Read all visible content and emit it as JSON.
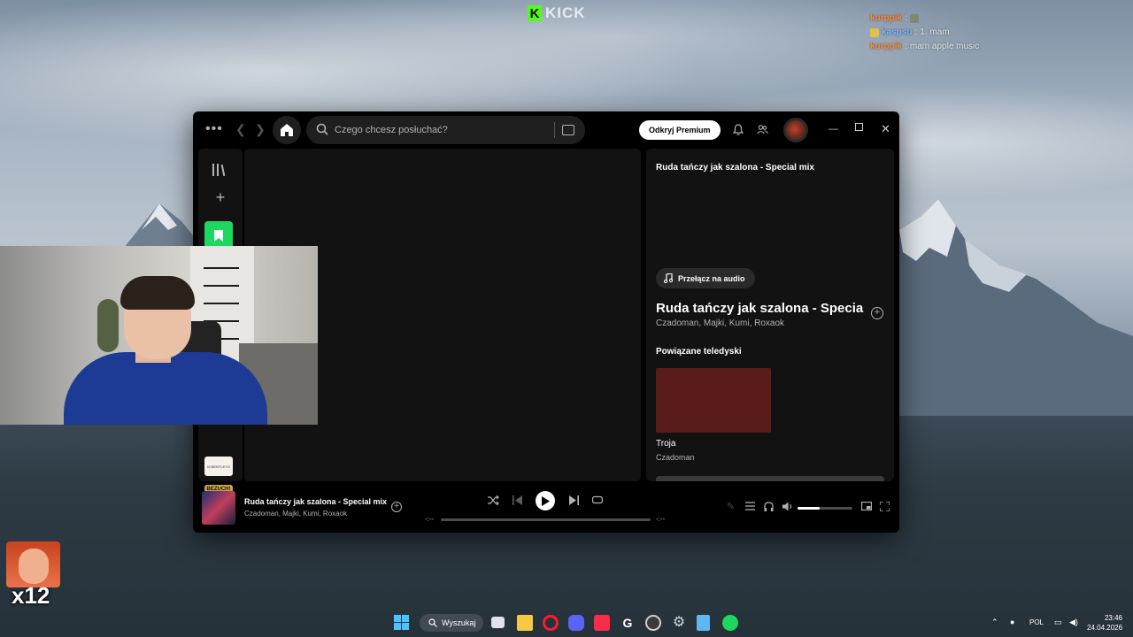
{
  "stream": {
    "brand": "KICK",
    "chat": [
      {
        "user": "kurppik",
        "message": "",
        "user_color": "#ff8a3d",
        "emote": true
      },
      {
        "user": "kaspsu",
        "message": "1. mam",
        "user_color": "#7ab7ff",
        "emote": true
      },
      {
        "user": "kurppik",
        "message": "mam apple music",
        "user_color": "#ff8a3d",
        "emote": false
      }
    ],
    "sub_badge_count": "x12"
  },
  "app": {
    "search_placeholder": "Czego chcesz posłuchać?",
    "premium_label": "Odkryj Premium",
    "now_playing_panel": {
      "header_title": "Ruda tańczy jak szalona - Special mix",
      "switch_label": "Przełącz na audio",
      "song_title": "Ruda tańczy jak szalona - Specia",
      "artists": "Czadoman, Majki, Kumi, Roxaok",
      "related_header": "Powiązane teledyski",
      "related": [
        {
          "title": "Troja",
          "artist": "Czadoman"
        }
      ]
    },
    "library_thumb_label": "M BENTLEYU",
    "library_thumb_b_label": "BEZUCH!",
    "player": {
      "title": "Ruda tańczy jak szalona - Special mix",
      "artist": "Czadoman, Majki, Kumi, Roxaok",
      "elapsed": "-:--",
      "remaining": "-:--",
      "volume": 0.4
    },
    "accent_color": "#1ed760"
  },
  "taskbar": {
    "search_label": "Wyszukaj",
    "language": "POL",
    "time": "23:46",
    "date": "24.04.2026"
  }
}
